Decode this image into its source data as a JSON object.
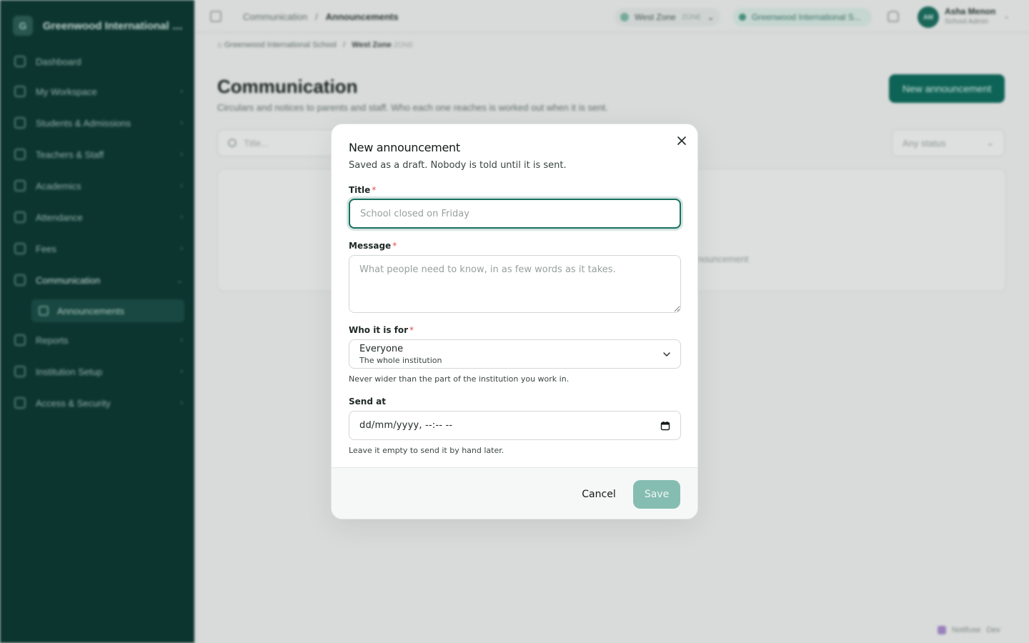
{
  "background": {
    "brand": {
      "name": "Greenwood International School",
      "logo_letter": "G"
    },
    "sidebar": {
      "items": [
        {
          "label": "Dashboard",
          "icon": "home-icon"
        },
        {
          "label": "My Workspace",
          "icon": "briefcase-icon"
        },
        {
          "label": "Students & Admissions",
          "icon": "graduation-cap-icon"
        },
        {
          "label": "Teachers & Staff",
          "icon": "users-icon"
        },
        {
          "label": "Academics",
          "icon": "book-icon"
        },
        {
          "label": "Attendance",
          "icon": "calendar-check-icon"
        },
        {
          "label": "Fees",
          "icon": "receipt-icon"
        },
        {
          "label": "Communication",
          "icon": "message-icon"
        },
        {
          "label": "Reports",
          "icon": "chart-icon"
        },
        {
          "label": "Institution Setup",
          "icon": "building-icon"
        },
        {
          "label": "Access & Security",
          "icon": "shield-icon"
        }
      ],
      "sub_item": "Announcements"
    },
    "topbar": {
      "crumb_section": "Communication",
      "crumb_page": "Announcements",
      "zone": "West Zone",
      "zone_code": "ZONE",
      "school_pill": "Greenwood International S...",
      "user_initials": "AM",
      "user_name": "Asha Menon",
      "user_role": "School Admin"
    },
    "breadcrumb": {
      "school": "Greenwood International School",
      "zone": "West Zone",
      "zone_code": "ZONE"
    },
    "page": {
      "title": "Communication",
      "subtitle": "Circulars and notices to parents and staff. Who each one reaches is worked out when it is sent.",
      "new_button": "New announcement",
      "search_placeholder": "Title...",
      "status_filter": "Any status",
      "empty_hint": "...nouncement"
    },
    "footer_badge": "Notifuse",
    "footer_badge_extra": "Dev"
  },
  "modal": {
    "title": "New announcement",
    "subtitle": "Saved as a draft. Nobody is told until it is sent.",
    "title_field": {
      "label": "Title",
      "required_mark": "*",
      "placeholder": "School closed on Friday",
      "value": ""
    },
    "message_field": {
      "label": "Message",
      "required_mark": "*",
      "placeholder": "What people need to know, in as few words as it takes.",
      "value": ""
    },
    "audience_field": {
      "label": "Who it is for",
      "required_mark": "*",
      "selected": "Everyone",
      "selected_description": "The whole institution",
      "hint": "Never wider than the part of the institution you work in."
    },
    "send_at_field": {
      "label": "Send at",
      "placeholder": "dd/mm/yyyy, --:-- --",
      "hint": "Leave it empty to send it by hand later."
    },
    "cancel_label": "Cancel",
    "save_label": "Save"
  },
  "colors": {
    "sidebar_bg": "#0e3a34",
    "accent": "#17705f",
    "save_disabled": "#86bdb2",
    "required": "#e5484d"
  }
}
